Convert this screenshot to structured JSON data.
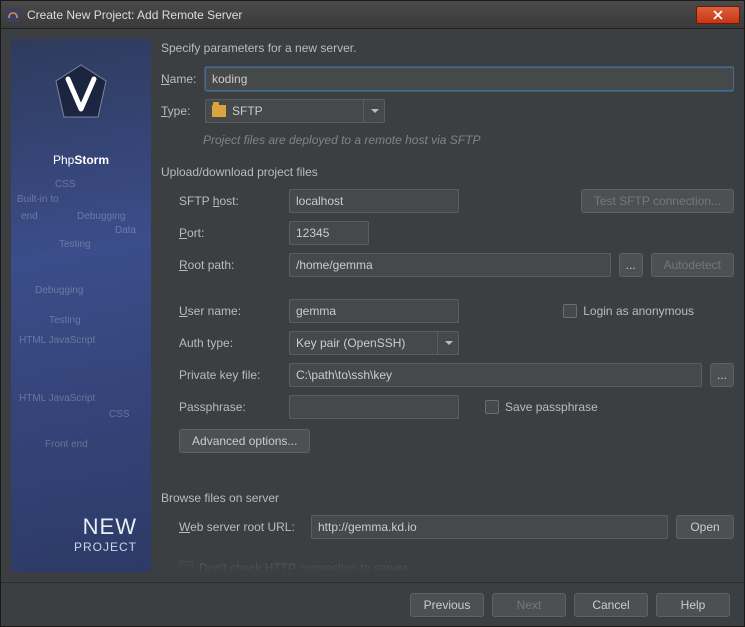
{
  "window": {
    "title": "Create New Project: Add Remote Server"
  },
  "intro": "Specify parameters for a new server.",
  "labels": {
    "name": "Name:",
    "type": "Type:",
    "hint": "Project files are deployed to a remote host via SFTP",
    "section_updown": "Upload/download project files",
    "sftp_host": "SFTP host:",
    "port": "Port:",
    "root_path": "Root path:",
    "user_name": "User name:",
    "auth_type": "Auth type:",
    "private_key": "Private key file:",
    "passphrase": "Passphrase:",
    "section_browse": "Browse files on server",
    "web_root": "Web server root URL:",
    "cut_checkbox": "Don't check HTTP connection to server"
  },
  "values": {
    "name": "koding",
    "type": "SFTP",
    "sftp_host": "localhost",
    "port": "12345",
    "root_path": "/home/gemma",
    "user_name": "gemma",
    "auth_type": "Key pair (OpenSSH)",
    "private_key": "C:\\path\\to\\ssh\\key",
    "passphrase": "",
    "web_root": "http://gemma.kd.io"
  },
  "buttons": {
    "test": "Test SFTP connection...",
    "autodetect": "Autodetect",
    "browse": "...",
    "advanced": "Advanced options...",
    "open": "Open",
    "previous": "Previous",
    "next": "Next",
    "cancel": "Cancel",
    "help": "Help"
  },
  "checks": {
    "anonymous": "Login as anonymous",
    "save_pass": "Save passphrase"
  },
  "sidebar": {
    "brand_php": "Php",
    "brand_storm": "Storm",
    "new": "NEW",
    "project": "PROJECT",
    "tags": [
      "CSS",
      "Built-in to",
      "end",
      "Debugging",
      "Data",
      "Testing",
      "Debugging",
      "Testing",
      "HTML JavaScript",
      "HTML JavaScript",
      "CSS",
      "Front end"
    ]
  }
}
